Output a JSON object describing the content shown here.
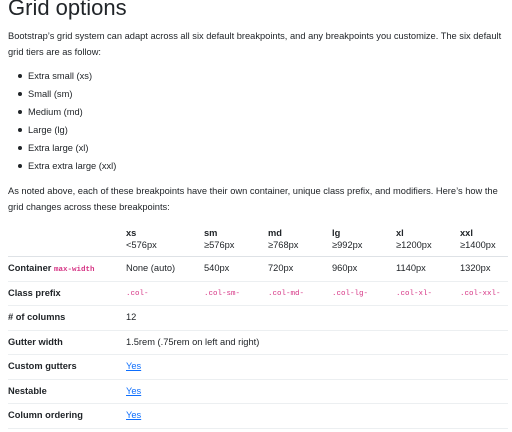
{
  "title": "Grid options",
  "intro": "Bootstrap’s grid system can adapt across all six default breakpoints, and any breakpoints you customize. The six default grid tiers are as follow:",
  "tiers": [
    "Extra small (xs)",
    "Small (sm)",
    "Medium (md)",
    "Large (lg)",
    "Extra large (xl)",
    "Extra extra large (xxl)"
  ],
  "note": "As noted above, each of these breakpoints have their own container, unique class prefix, and modifiers. Here’s how the grid changes across these breakpoints:",
  "table": {
    "headers": [
      {
        "bp": "xs",
        "px": "<576px"
      },
      {
        "bp": "sm",
        "px": "≥576px"
      },
      {
        "bp": "md",
        "px": "≥768px"
      },
      {
        "bp": "lg",
        "px": "≥992px"
      },
      {
        "bp": "xl",
        "px": "≥1200px"
      },
      {
        "bp": "xxl",
        "px": "≥1400px"
      }
    ],
    "container": {
      "label": "Container",
      "code": "max-width",
      "values": [
        "None (auto)",
        "540px",
        "720px",
        "960px",
        "1140px",
        "1320px"
      ]
    },
    "class_prefix": {
      "label": "Class prefix",
      "values": [
        ".col-",
        ".col-sm-",
        ".col-md-",
        ".col-lg-",
        ".col-xl-",
        ".col-xxl-"
      ]
    },
    "columns": {
      "label": "# of columns",
      "value": "12"
    },
    "gutter": {
      "label": "Gutter width",
      "value": "1.5rem (.75rem on left and right)"
    },
    "custom_gutters": {
      "label": "Custom gutters",
      "value": "Yes"
    },
    "nestable": {
      "label": "Nestable",
      "value": "Yes"
    },
    "column_ordering": {
      "label": "Column ordering",
      "value": "Yes"
    }
  },
  "colors": {
    "text": "#212529",
    "code": "#d63384",
    "link": "#0d6efd",
    "border": "#dee2e6"
  }
}
